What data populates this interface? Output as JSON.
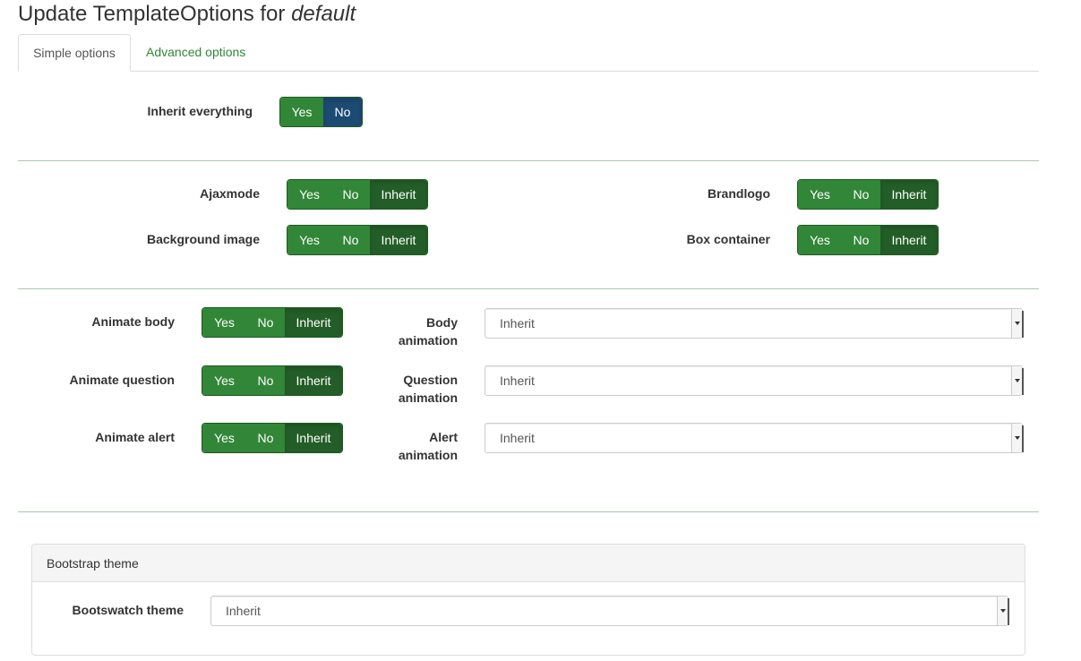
{
  "page": {
    "title_prefix": "Update TemplateOptions for",
    "title_template": "default"
  },
  "tabs": [
    {
      "label": "Simple options",
      "active": true
    },
    {
      "label": "Advanced options",
      "active": false
    }
  ],
  "buttons": {
    "yes": "Yes",
    "no": "No",
    "inherit": "Inherit"
  },
  "inherit_everything": {
    "label": "Inherit everything",
    "selected": "No"
  },
  "options": {
    "ajaxmode": {
      "label": "Ajaxmode",
      "selected": "Inherit"
    },
    "brandlogo": {
      "label": "Brandlogo",
      "selected": "Inherit"
    },
    "background_image": {
      "label": "Background image",
      "selected": "Inherit"
    },
    "box_container": {
      "label": "Box container",
      "selected": "Inherit"
    }
  },
  "animations": [
    {
      "toggle_label": "Animate body",
      "toggle_selected": "Inherit",
      "select_label_1": "Body",
      "select_label_2": "animation",
      "select_value": "Inherit"
    },
    {
      "toggle_label": "Animate question",
      "toggle_selected": "Inherit",
      "select_label_1": "Question",
      "select_label_2": "animation",
      "select_value": "Inherit"
    },
    {
      "toggle_label": "Animate alert",
      "toggle_selected": "Inherit",
      "select_label_1": "Alert",
      "select_label_2": "animation",
      "select_value": "Inherit"
    }
  ],
  "bootstrap_panel": {
    "heading": "Bootstrap theme",
    "field_label": "Bootswatch theme",
    "field_value": "Inherit"
  },
  "colors": {
    "primary_green": "#328637",
    "active_green": "#235d27",
    "active_blue": "#1c4a73",
    "link_green": "#328637"
  }
}
